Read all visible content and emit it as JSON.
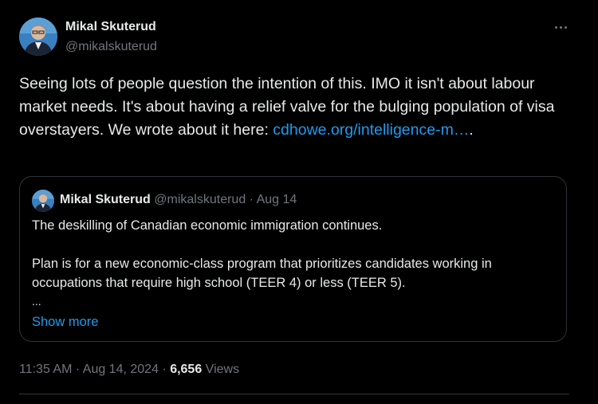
{
  "tweet": {
    "author_name": "Mikal Skuterud",
    "author_handle": "@mikalskuterud",
    "text": "Seeing lots of people question the intention of this. IMO it isn't about labour market needs. It's about having a relief valve for the bulging population of visa overstayers. We wrote about it here: ",
    "link_text": "cdhowe.org/intelligence-m…",
    "link_suffix": ".",
    "more_icon": "ellipsis-icon"
  },
  "quote": {
    "author_name": "Mikal Skuterud",
    "author_handle": "@mikalskuterud",
    "separator": " · ",
    "date": "Aug 14",
    "paragraph1": "The deskilling of Canadian economic immigration continues.",
    "paragraph2": "Plan is for a new economic-class program that prioritizes candidates working in occupations that require high school (TEER 4) or less (TEER 5).",
    "truncation": "...",
    "show_more": "Show more"
  },
  "meta": {
    "time": "11:35 AM",
    "separator": " · ",
    "date": "Aug 14, 2024",
    "views_count": "6,656",
    "views_label": " Views"
  },
  "colors": {
    "background": "#000000",
    "text": "#e7e9ea",
    "muted": "#71767b",
    "link": "#1d9bf0",
    "border": "#2f3336"
  }
}
